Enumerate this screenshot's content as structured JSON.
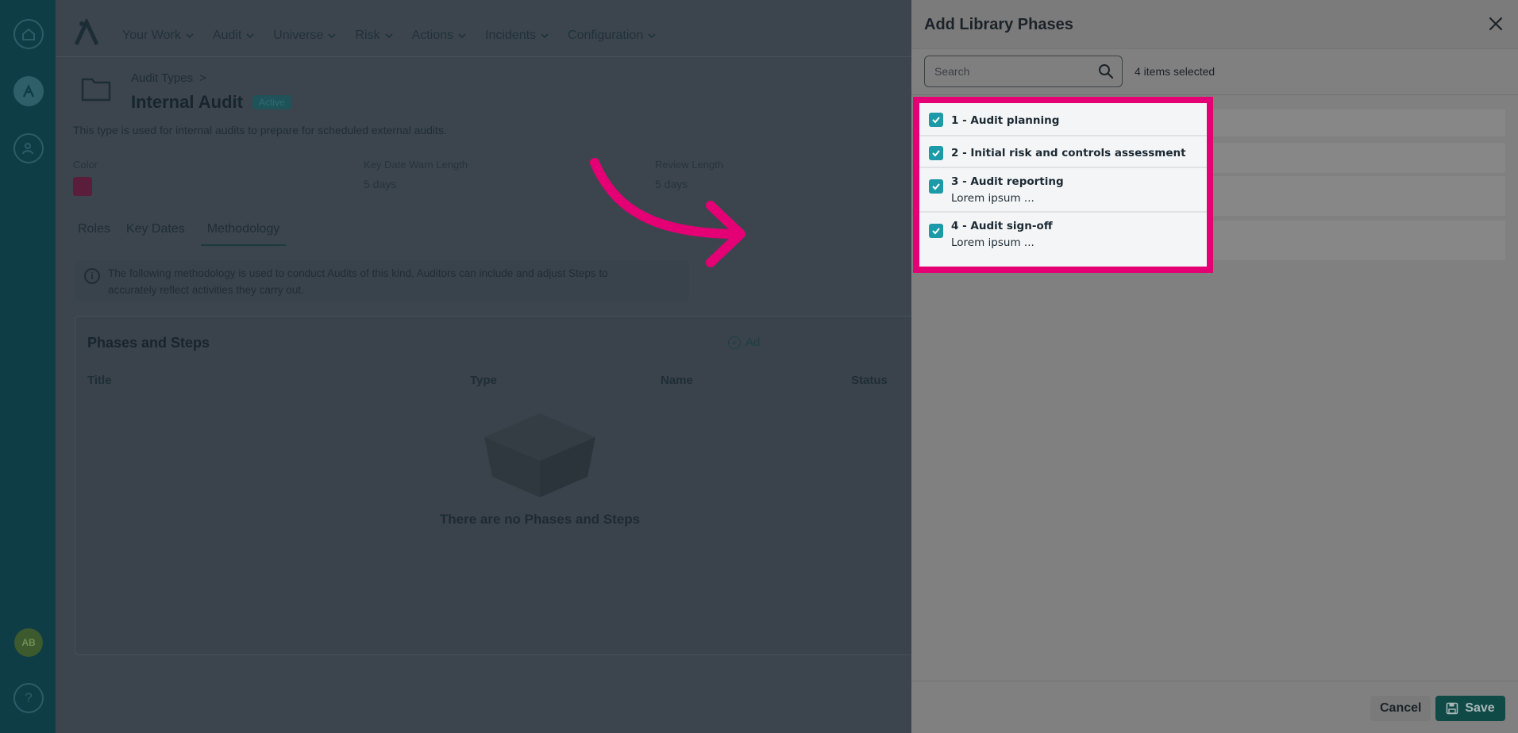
{
  "nav": {
    "items": [
      {
        "label": "Your Work"
      },
      {
        "label": "Audit"
      },
      {
        "label": "Universe"
      },
      {
        "label": "Risk"
      },
      {
        "label": "Actions"
      },
      {
        "label": "Incidents"
      },
      {
        "label": "Configuration"
      }
    ]
  },
  "rail": {
    "icons": [
      "home-icon",
      "app-logo-icon",
      "user-settings-icon"
    ],
    "avatar": "AB",
    "help": "?"
  },
  "page": {
    "breadcrumb": "Audit Types",
    "breadcrumb_sep": ">",
    "title": "Internal Audit",
    "status": "Active",
    "description": "This type is used for internal audits to prepare for scheduled external audits.",
    "color_label": "Color",
    "color_value": "#5a1e3c",
    "key_date_label": "Key Date Warn Length",
    "key_date_value": "5 days",
    "review_label": "Review Length",
    "review_value": "5 days",
    "tabs": [
      {
        "label": "Roles"
      },
      {
        "label": "Key Dates"
      },
      {
        "label": "Methodology"
      }
    ],
    "info_line1": "The following methodology is used to conduct Audits of this kind. Auditors can include and adjust Steps to",
    "info_line2": "accurately reflect activities they carry out.",
    "phases_title": "Phases and Steps",
    "add_label": "Ad",
    "columns": [
      "Title",
      "Type",
      "Name",
      "Status"
    ],
    "empty_text": "There are no Phases and Steps"
  },
  "drawer": {
    "title": "Add Library Phases",
    "search_placeholder": "Search",
    "selected_count": "4 items selected",
    "phases": [
      {
        "title": "1 - Audit planning",
        "subtitle": "",
        "checked": true
      },
      {
        "title": "2 - Initial risk and controls assessment",
        "subtitle": "",
        "checked": true
      },
      {
        "title": "3 - Audit reporting",
        "subtitle": "Lorem ipsum ...",
        "checked": true
      },
      {
        "title": "4 - Audit sign-off",
        "subtitle": "Lorem ipsum ...",
        "checked": true
      }
    ],
    "cancel_label": "Cancel",
    "save_label": "Save"
  },
  "colors": {
    "accent": "#1d9aa8",
    "highlight": "#e40074",
    "primary_button": "#0f4a47"
  }
}
